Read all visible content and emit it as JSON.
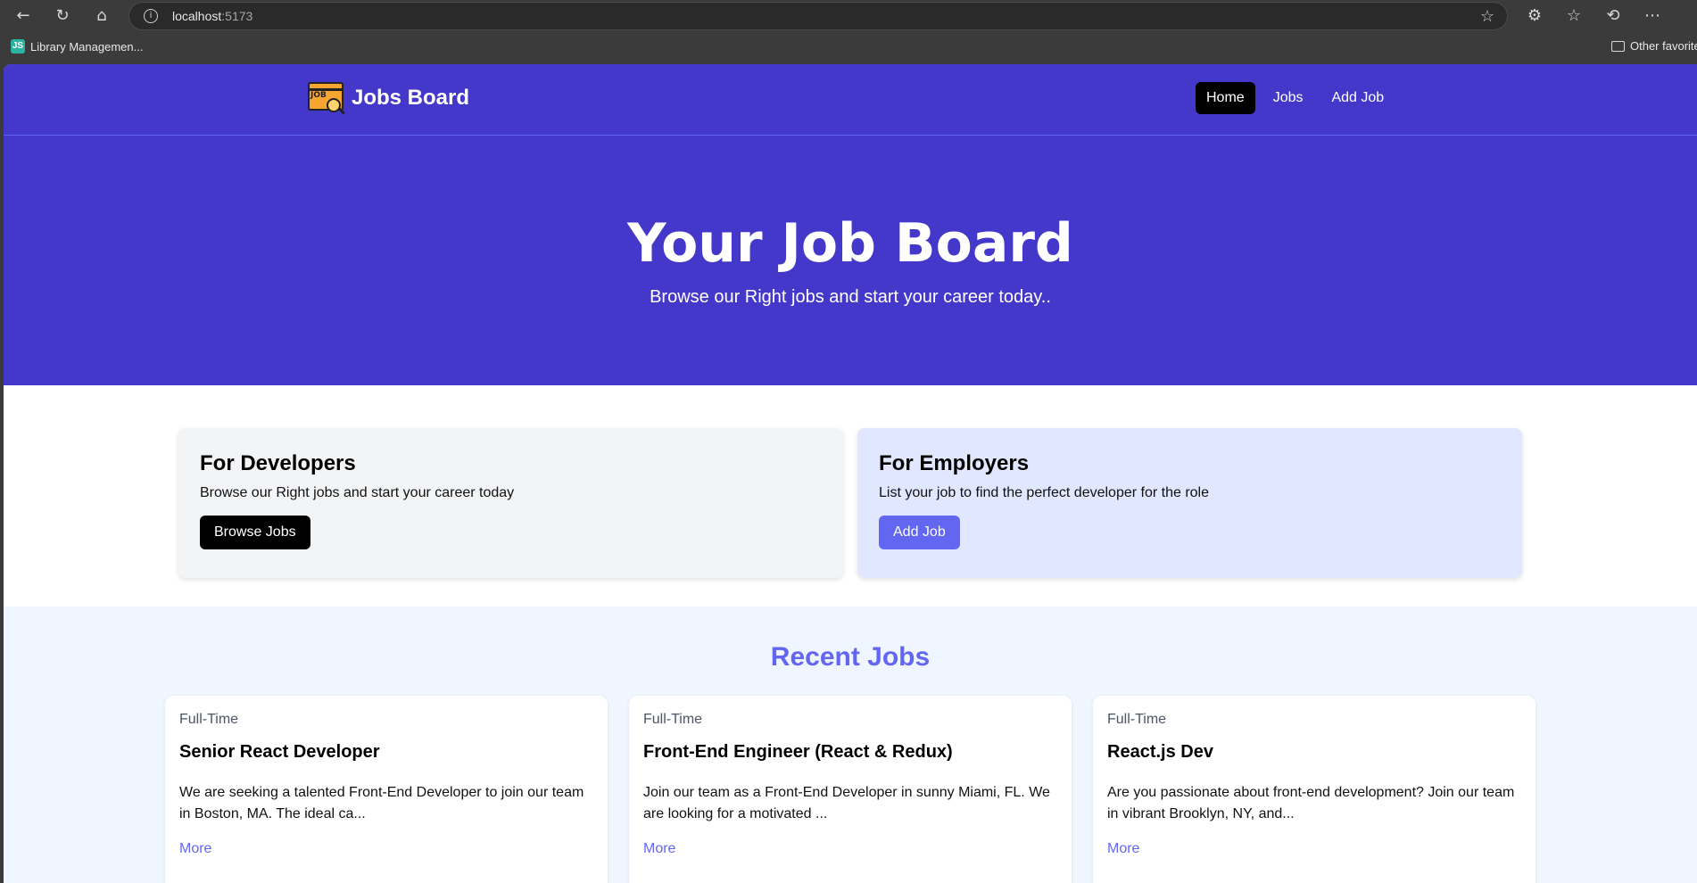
{
  "browser": {
    "url_host": "localhost",
    "url_port": ":5173",
    "bookmark": "Library Managemen...",
    "other_favorites": "Other favorite"
  },
  "nav": {
    "brand": "Jobs Board",
    "logo_text": "JOB",
    "links": [
      "Home",
      "Jobs",
      "Add Job"
    ]
  },
  "hero": {
    "title": "Your Job Board",
    "subtitle": "Browse our Right jobs and start your career today.."
  },
  "cards": {
    "developers": {
      "title": "For Developers",
      "text": "Browse our Right jobs and start your career today",
      "button": "Browse Jobs"
    },
    "employers": {
      "title": "For Employers",
      "text": "List your job to find the perfect developer for the role",
      "button": "Add Job"
    }
  },
  "recent": {
    "title": "Recent Jobs",
    "jobs": [
      {
        "type": "Full-Time",
        "title": "Senior React Developer",
        "desc": "We are seeking a talented Front-End Developer to join our team in Boston, MA. The ideal ca...",
        "more": "More"
      },
      {
        "type": "Full-Time",
        "title": "Front-End Engineer (React & Redux)",
        "desc": "Join our team as a Front-End Developer in sunny Miami, FL. We are looking for a motivated ...",
        "more": "More"
      },
      {
        "type": "Full-Time",
        "title": "React.js Dev",
        "desc": "Are you passionate about front-end development? Join our team in vibrant Brooklyn, NY, and...",
        "more": "More"
      }
    ]
  },
  "colors": {
    "primary": "#4338ca",
    "accent": "#6366f1",
    "developer_card": "#f3f4f6",
    "employer_card": "#e0e7ff",
    "recent_bg": "#eff6ff"
  }
}
